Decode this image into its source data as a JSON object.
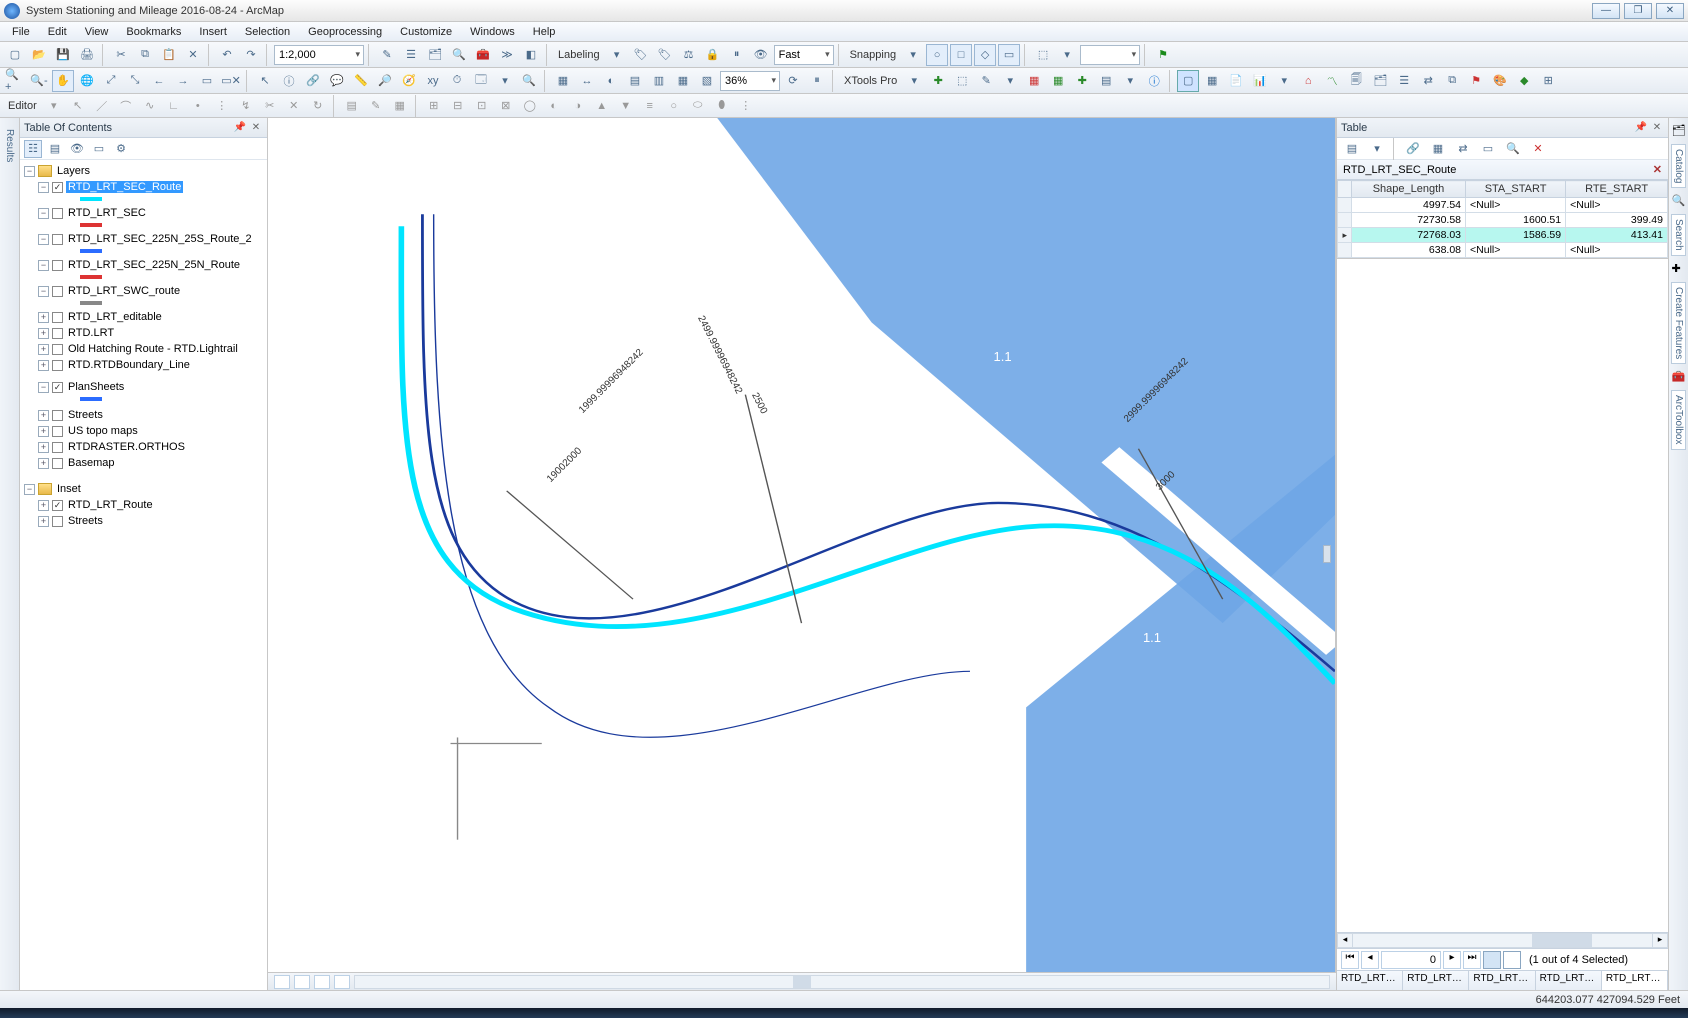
{
  "window": {
    "title": "System Stationing and Mileage 2016-08-24 - ArcMap",
    "min": "—",
    "max": "❐",
    "close": "✕"
  },
  "menu": [
    "File",
    "Edit",
    "View",
    "Bookmarks",
    "Insert",
    "Selection",
    "Geoprocessing",
    "Customize",
    "Windows",
    "Help"
  ],
  "toolbar1": {
    "scale": "1:2,000",
    "labeling": "Labeling",
    "fast": "Fast",
    "snapping": "Snapping",
    "xtools": "XTools Pro"
  },
  "toolbar2": {
    "zoom_pct": "36%"
  },
  "editor": {
    "label": "Editor"
  },
  "toc": {
    "title": "Table Of Contents",
    "root": "Layers",
    "selected": "RTD_LRT_SEC_Route",
    "layers": [
      {
        "name": "RTD_LRT_SEC_Route",
        "checked": true,
        "swatch": "cyan"
      },
      {
        "name": "RTD_LRT_SEC",
        "checked": false,
        "swatch": "red"
      },
      {
        "name": "RTD_LRT_SEC_225N_25S_Route_2",
        "checked": false,
        "swatch": "blue"
      },
      {
        "name": "RTD_LRT_SEC_225N_25N_Route",
        "checked": false,
        "swatch": "red"
      },
      {
        "name": "RTD_LRT_SWC_route",
        "checked": false,
        "swatch": "grey"
      },
      {
        "name": "RTD_LRT_editable",
        "checked": false
      },
      {
        "name": "RTD.LRT",
        "checked": false
      },
      {
        "name": "Old Hatching Route - RTD.Lightrail",
        "checked": false
      },
      {
        "name": "RTD.RTDBoundary_Line",
        "checked": false
      },
      {
        "name": "PlanSheets",
        "checked": true,
        "swatch": "blue",
        "gap": true
      },
      {
        "name": "Streets",
        "checked": false,
        "gap": true
      },
      {
        "name": "US topo maps",
        "checked": false
      },
      {
        "name": "RTDRASTER.ORTHOS",
        "checked": false
      },
      {
        "name": "Basemap",
        "checked": false
      }
    ],
    "inset": {
      "label": "Inset",
      "items": [
        {
          "name": "RTD_LRT_Route",
          "checked": true
        },
        {
          "name": "Streets",
          "checked": false
        }
      ]
    }
  },
  "map": {
    "annotations": {
      "a1": "2499.99996948242",
      "a2": "2500",
      "a3": "1999.99996948242",
      "a4": "19002000",
      "a5": "2999.99996948242",
      "a6": "3000",
      "p1": "1.1",
      "p2": "1.1"
    }
  },
  "side_left": {
    "results": "Results"
  },
  "side_right": {
    "catalog": "Catalog",
    "search": "Search",
    "create": "Create Features",
    "toolbox": "ArcToolbox"
  },
  "table": {
    "title": "Table",
    "layer": "RTD_LRT_SEC_Route",
    "cols": [
      "Shape_Length",
      "STA_START",
      "RTE_START"
    ],
    "rows": [
      {
        "sel": false,
        "vals": [
          "4997.54",
          "<Null>",
          "<Null>"
        ],
        "align": [
          "r",
          "l",
          "l"
        ]
      },
      {
        "sel": false,
        "vals": [
          "72730.58",
          "1600.51",
          "399.49"
        ],
        "align": [
          "r",
          "r",
          "r"
        ]
      },
      {
        "sel": true,
        "vals": [
          "72768.03",
          "1586.59",
          "413.41"
        ],
        "align": [
          "r",
          "r",
          "r"
        ],
        "arrow": true
      },
      {
        "sel": false,
        "vals": [
          "638.08",
          "<Null>",
          "<Null>"
        ],
        "align": [
          "r",
          "l",
          "l"
        ]
      }
    ],
    "nav": {
      "pos": "0",
      "status": "(1 out of 4 Selected)"
    },
    "tabs": [
      "RTD_LRT_S...",
      "RTD_LRT_e...",
      "RTD_LRT_S...",
      "RTD_LRT_S...",
      "RTD_LRT_S..."
    ]
  },
  "status": {
    "coords": "644203.077 427094.529 Feet"
  }
}
